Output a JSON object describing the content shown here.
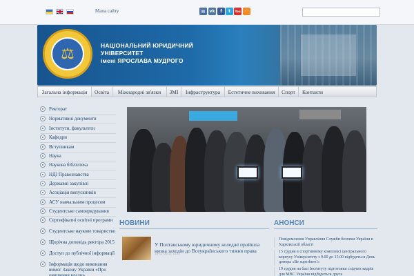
{
  "topbar": {
    "languages": [
      "Українська",
      "English",
      "Русский"
    ],
    "sitemap_label": "Мапа сайту",
    "social_icons": [
      "news-icon",
      "vk-icon",
      "facebook-icon",
      "twitter-icon",
      "youtube-icon",
      "rss-icon"
    ],
    "social_glyphs": [
      "▤",
      "vk",
      "f",
      "t",
      "You",
      "◠"
    ],
    "search_placeholder": ""
  },
  "header": {
    "title_lines": [
      "НАЦІОНАЛЬНИЙ ЮРИДИЧНИЙ",
      "УНІВЕРСИТЕТ",
      "імені ЯРОСЛАВА МУДРОГО"
    ],
    "logo_glyph": "⚖"
  },
  "nav": {
    "items": [
      "Загальна інформація",
      "Освіта",
      "Міжнародні зв'язки",
      "ЗМІ",
      "Інфраструктура",
      "Естетичне виховання",
      "Спорт",
      "Контакти"
    ]
  },
  "sidebar": {
    "items": [
      "Ректорат",
      "Нормативні документи",
      "Інститути, факультети",
      "Кафедри",
      "Вступникам",
      "Наука",
      "Наукова бібліотека",
      "НДІ Правознавства",
      "Державні закупівлі",
      "Асоціація випускників",
      "АСУ навчальним процесом",
      "Студентське самоврядування",
      "Сертифікатні освітні програми",
      "Студентське наукове товариство",
      "Щорічна доповідь ректора 2015",
      "Доступ до публічної інформації",
      "Інформація щодо виконання вимог Закону України «Про очищення влади»"
    ]
  },
  "news": {
    "section_title": "НОВИНИ",
    "items": [
      {
        "headline": "У Полтавському юридичному коледжі пройшла низка заходів до Всеукраїнського тижня права",
        "date": "14-12-2015, 13:21"
      }
    ]
  },
  "announcements": {
    "section_title": "АНОНСИ",
    "items": [
      "Повідомлення Управління Служби безпеки України в Харківській області",
      "15 грудня в спортивному комплексі центрального корпусу Університету з 9.00 до 15.00 відбудеться День донора «Be superhero!»",
      "19 грудня на базі Інституту підготовки слідчих кадрів для МВС України відбудеться друга"
    ]
  },
  "colors": {
    "header_blue": "#1e6aa8",
    "section_title": "#5486b8",
    "link": "#20476f",
    "page_bg": "#e3e8ee"
  }
}
